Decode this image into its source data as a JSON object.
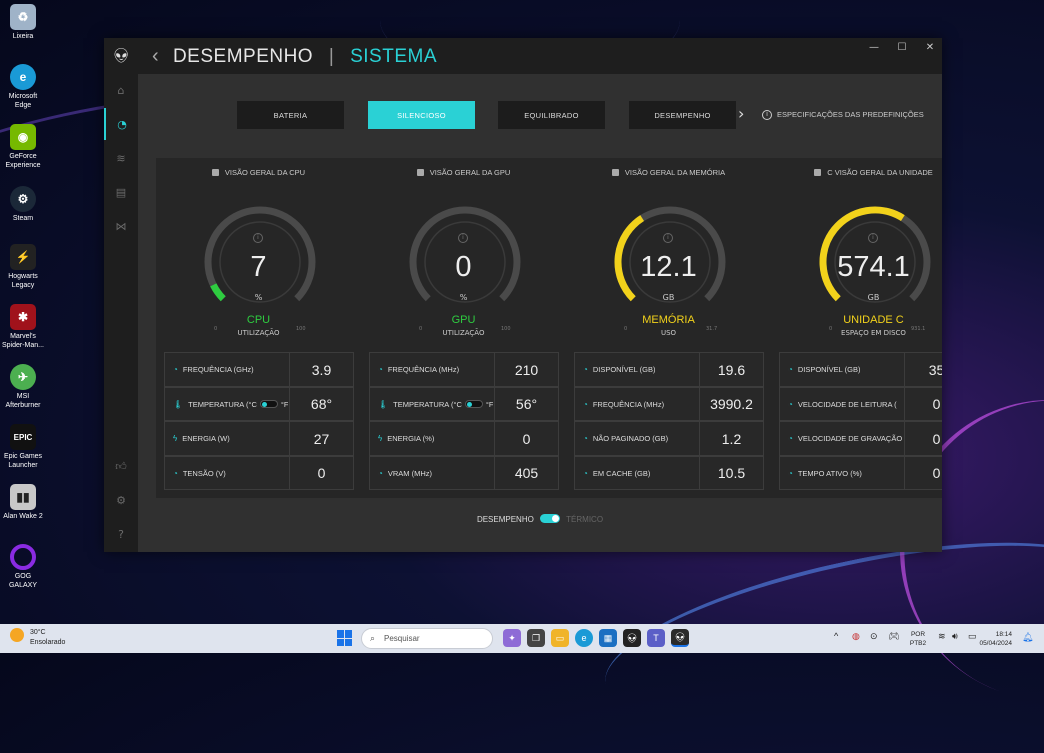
{
  "desktop": {
    "icons": [
      {
        "label": "Lixeira",
        "icon": "recycle-bin-icon",
        "color": "#9fb3c8"
      },
      {
        "label": "Microsoft Edge",
        "icon": "edge-icon",
        "color": "#1a9ad6"
      },
      {
        "label": "GeForce Experience",
        "icon": "nvidia-icon",
        "color": "#76b900"
      },
      {
        "label": "Steam",
        "icon": "steam-icon",
        "color": "#1b2838"
      },
      {
        "label": "Hogwarts Legacy",
        "icon": "hogwarts-icon",
        "color": "#222222"
      },
      {
        "label": "Marvel's Spider-Man...",
        "icon": "spiderman-icon",
        "color": "#a0121b"
      },
      {
        "label": "MSI Afterburner",
        "icon": "msi-afterburner-icon",
        "color": "#4caf50"
      },
      {
        "label": "Epic Games Launcher",
        "icon": "epic-games-icon",
        "color": "#111111"
      },
      {
        "label": "Alan Wake 2",
        "icon": "alan-wake-icon",
        "color": "#c8c8c8"
      },
      {
        "label": "GOG GALAXY",
        "icon": "gog-galaxy-icon",
        "color": "#8a2be2"
      }
    ]
  },
  "app": {
    "title_section": "DESEMPENHO",
    "title_separator": "|",
    "title_page": "SISTEMA",
    "accent_color": "#2ad1d5",
    "window_controls": {
      "minimize": "—",
      "maximize": "☐",
      "close": "✕"
    },
    "presets": {
      "items": [
        "BATERIA",
        "SILENCIOSO",
        "EQUILIBRADO",
        "DESEMPENHO"
      ],
      "active": "SILENCIOSO",
      "specs_label": "ESPECIFICAÇÕES DAS PREDEFINIÇÕES"
    },
    "cards": [
      {
        "title": "VISÃO GERAL DA CPU",
        "value": "7",
        "unit": "%",
        "name": "CPU",
        "name_color": "#2ecc40",
        "sub": "UTILIZAÇÃO",
        "fill_percent": 7,
        "arc_color": "#2ecc40",
        "gmin": "0",
        "gmax": "100",
        "metrics": [
          {
            "label": "FREQUÊNCIA (GHz)",
            "value": "3.9",
            "icon": "gauge-icon"
          },
          {
            "label": "TEMPERATURA (°C",
            "label_suffix": "°F)",
            "value": "68°",
            "icon": "thermometer-icon",
            "toggle": true
          },
          {
            "label": "ENERGIA (W)",
            "value": "27",
            "icon": "bolt-icon"
          },
          {
            "label": "TENSÃO (V)",
            "value": "0",
            "icon": "gauge-icon"
          }
        ]
      },
      {
        "title": "VISÃO GERAL DA GPU",
        "value": "0",
        "unit": "%",
        "name": "GPU",
        "name_color": "#2ecc40",
        "sub": "UTILIZAÇÃO",
        "fill_percent": 0,
        "arc_color": "#2ecc40",
        "gmin": "0",
        "gmax": "100",
        "metrics": [
          {
            "label": "FREQUÊNCIA (MHz)",
            "value": "210",
            "icon": "gauge-icon"
          },
          {
            "label": "TEMPERATURA (°C",
            "label_suffix": "°F)",
            "value": "56°",
            "icon": "thermometer-icon",
            "toggle": true
          },
          {
            "label": "ENERGIA (%)",
            "value": "0",
            "icon": "bolt-icon"
          },
          {
            "label": "VRAM (MHz)",
            "value": "405",
            "icon": "gauge-icon"
          }
        ]
      },
      {
        "title": "VISÃO GERAL DA MEMÓRIA",
        "value": "12.1",
        "unit": "GB",
        "name": "MEMÓRIA",
        "name_color": "#f2d21b",
        "sub": "USO",
        "fill_percent": 38,
        "arc_color": "#f2d21b",
        "gmin": "0",
        "gmax": "31.7",
        "metrics": [
          {
            "label": "DISPONÍVEL (GB)",
            "value": "19.6",
            "icon": "gauge-icon"
          },
          {
            "label": "FREQUÊNCIA (MHz)",
            "value": "3990.2",
            "icon": "gauge-icon"
          },
          {
            "label": "NÃO PAGINADO (GB)",
            "value": "1.2",
            "icon": "gauge-icon"
          },
          {
            "label": "EM CACHE (GB)",
            "value": "10.5",
            "icon": "gauge-icon"
          }
        ]
      },
      {
        "title": "C VISÃO GERAL DA UNIDADE",
        "value": "574.1",
        "unit": "GB",
        "name": "UNIDADE C",
        "name_color": "#f2d21b",
        "sub": "ESPAÇO EM DISCO",
        "fill_percent": 62,
        "arc_color": "#f2d21b",
        "gmin": "0",
        "gmax": "931.1",
        "metrics": [
          {
            "label": "DISPONÍVEL (GB)",
            "value": "35",
            "icon": "gauge-icon"
          },
          {
            "label": "VELOCIDADE DE LEITURA (",
            "value": "0",
            "icon": "gauge-icon"
          },
          {
            "label": "VELOCIDADE DE GRAVAÇÃO",
            "value": "0",
            "icon": "gauge-icon"
          },
          {
            "label": "TEMPO ATIVO (%)",
            "value": "0",
            "icon": "gauge-icon"
          }
        ]
      }
    ],
    "mode_switch": {
      "left": "DESEMPENHO",
      "right": "TÉRMICO"
    }
  },
  "taskbar": {
    "weather_temp": "30°C",
    "weather_desc": "Ensolarado",
    "weather_badge": "1",
    "search_placeholder": "Pesquisar",
    "lang_line1": "POR",
    "lang_line2": "PTB2",
    "time": "18:14",
    "date": "05/04/2024"
  }
}
